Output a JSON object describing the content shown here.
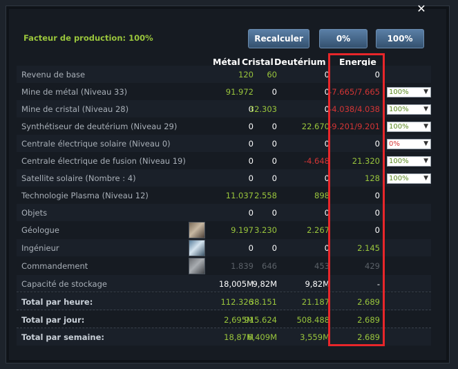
{
  "header": {
    "factor_label": "Facteur de production: 100%",
    "buttons": {
      "recalc": "Recalculer",
      "zero": "0%",
      "hundred": "100%"
    },
    "close_icon": "close-icon"
  },
  "columns": {
    "metal": "Métal",
    "crystal": "Cristal",
    "deut": "Deutérium",
    "energy": "Energie"
  },
  "rows": [
    {
      "label": "Revenu de base",
      "metal": "120",
      "crystal": "60",
      "deut": "0",
      "energy": "0"
    },
    {
      "label": "Mine de métal (Niveau 33)",
      "metal": "91.972",
      "crystal": "0",
      "deut": "0",
      "energy": "-7.665/7.665",
      "select": "100%"
    },
    {
      "label": "Mine de cristal (Niveau 28)",
      "metal": "0",
      "crystal": "32.303",
      "deut": "0",
      "energy": "-4.038/4.038",
      "select": "100%"
    },
    {
      "label": "Synthétiseur de deutérium (Niveau 29)",
      "metal": "0",
      "crystal": "0",
      "deut": "22.670",
      "energy": "-9.201/9.201",
      "select": "100%"
    },
    {
      "label": "Centrale électrique solaire (Niveau 0)",
      "metal": "0",
      "crystal": "0",
      "deut": "0",
      "energy": "0",
      "select": "0%"
    },
    {
      "label": "Centrale électrique de fusion (Niveau 19)",
      "metal": "0",
      "crystal": "0",
      "deut": "-4.648",
      "energy": "21.320",
      "select": "100%"
    },
    {
      "label": "Satellite solaire (Nombre : 4)",
      "metal": "0",
      "crystal": "0",
      "deut": "0",
      "energy": "128",
      "select": "100%"
    },
    {
      "label": "Technologie Plasma (Niveau 12)",
      "metal": "11.037",
      "crystal": "2.558",
      "deut": "898",
      "energy": "0"
    },
    {
      "label": "Objets",
      "metal": "0",
      "crystal": "0",
      "deut": "0",
      "energy": "0"
    },
    {
      "label": "Géologue",
      "metal": "9.197",
      "crystal": "3.230",
      "deut": "2.267",
      "energy": "0"
    },
    {
      "label": "Ingénieur",
      "metal": "0",
      "crystal": "0",
      "deut": "0",
      "energy": "2.145"
    },
    {
      "label": "Commandement",
      "metal": "1.839",
      "crystal": "646",
      "deut": "453",
      "energy": "429"
    },
    {
      "label": "Capacité de stockage",
      "metal": "18,005M",
      "crystal": "9,82M",
      "deut": "9,82M",
      "energy": "-"
    }
  ],
  "totals": [
    {
      "label": "Total par heure:",
      "metal": "112.326",
      "crystal": "38.151",
      "deut": "21.187",
      "energy": "2.689"
    },
    {
      "label": "Total par jour:",
      "metal": "2,695M",
      "crystal": "915.624",
      "deut": "508.488",
      "energy": "2.689"
    },
    {
      "label": "Total par semaine:",
      "metal": "18,87M",
      "crystal": "6,409M",
      "deut": "3,559M",
      "energy": "2.689"
    }
  ],
  "colors": {
    "positive": "#9ac63c",
    "negative": "#d43535",
    "highlight_box": "#e8262a"
  }
}
